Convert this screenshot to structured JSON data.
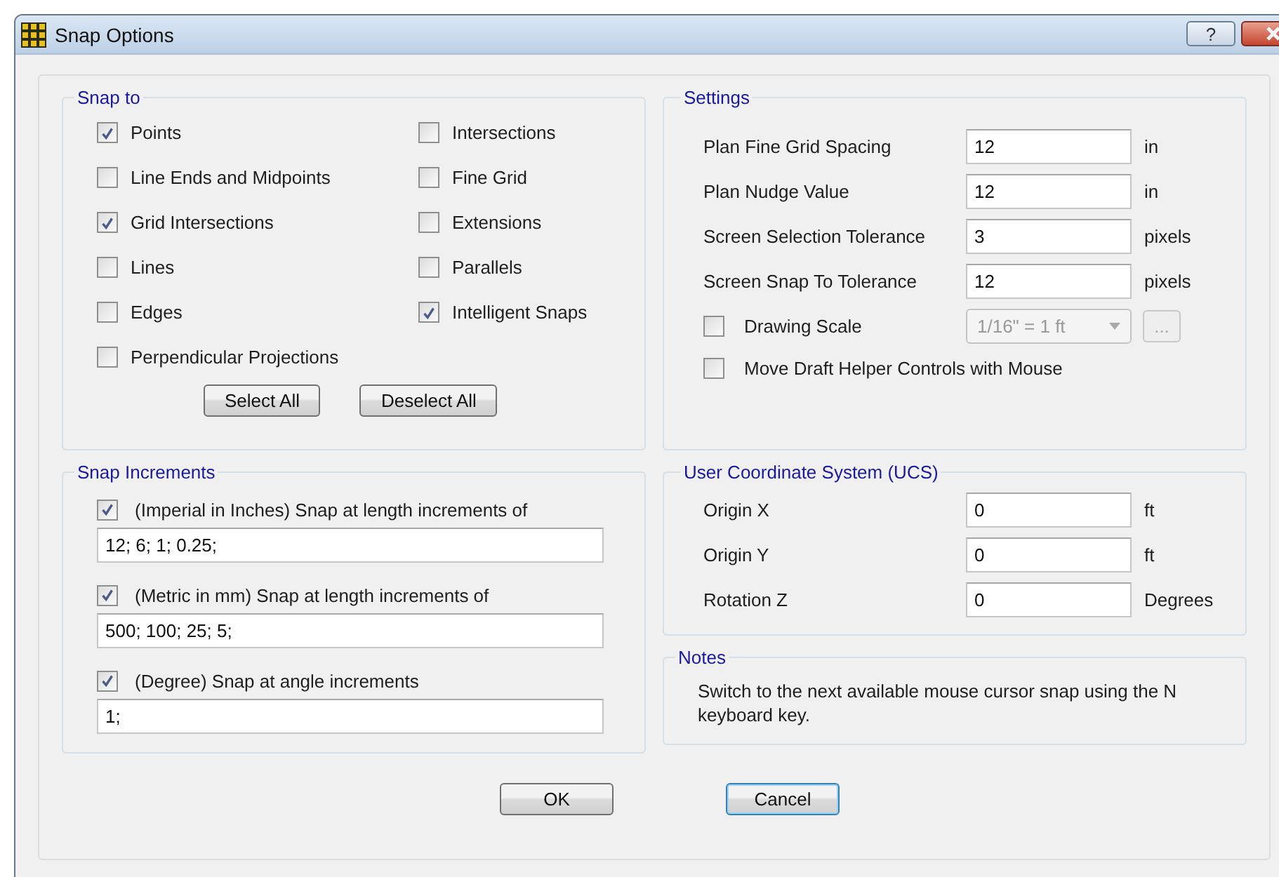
{
  "window": {
    "title": "Snap Options",
    "help": "?"
  },
  "snap_to": {
    "title": "Snap to",
    "columns": [
      [
        {
          "label": "Points",
          "checked": true
        },
        {
          "label": "Line Ends and Midpoints",
          "checked": false
        },
        {
          "label": "Grid Intersections",
          "checked": true
        },
        {
          "label": "Lines",
          "checked": false
        },
        {
          "label": "Edges",
          "checked": false
        },
        {
          "label": "Perpendicular Projections",
          "checked": false
        }
      ],
      [
        {
          "label": "Intersections",
          "checked": false
        },
        {
          "label": "Fine Grid",
          "checked": false
        },
        {
          "label": "Extensions",
          "checked": false
        },
        {
          "label": "Parallels",
          "checked": false
        },
        {
          "label": "Intelligent Snaps",
          "checked": true
        }
      ]
    ],
    "buttons": [
      "Select All",
      "Deselect All"
    ]
  },
  "settings": {
    "title": "Settings",
    "fields": [
      {
        "label": "Plan Fine Grid Spacing",
        "value": "12",
        "unit": "in"
      },
      {
        "label": "Plan Nudge Value",
        "value": "12",
        "unit": "in"
      },
      {
        "label": "Screen Selection Tolerance",
        "value": "3",
        "unit": "pixels"
      },
      {
        "label": "Screen Snap To Tolerance",
        "value": "12",
        "unit": "pixels"
      }
    ],
    "drawing_scale": {
      "label": "Drawing Scale",
      "checked": false,
      "value": "1/16\" = 1 ft",
      "disabled": true,
      "browse": "..."
    },
    "move_helper": {
      "label": "Move Draft Helper Controls with Mouse",
      "checked": false
    }
  },
  "snap_increments": {
    "title": "Snap Increments",
    "items": [
      {
        "label": "(Imperial in Inches) Snap at length increments of",
        "checked": true,
        "value": "12; 6; 1; 0.25;"
      },
      {
        "label": "(Metric in mm) Snap at length increments of",
        "checked": true,
        "value": "500; 100; 25; 5;"
      },
      {
        "label": "(Degree) Snap at angle increments",
        "checked": true,
        "value": "1;"
      }
    ]
  },
  "ucs": {
    "title": "User Coordinate System (UCS)",
    "fields": [
      {
        "label": "Origin X",
        "value": "0",
        "unit": "ft"
      },
      {
        "label": "Origin Y",
        "value": "0",
        "unit": "ft"
      },
      {
        "label": "Rotation Z",
        "value": "0",
        "unit": "Degrees"
      }
    ]
  },
  "notes": {
    "title": "Notes",
    "text": "Switch to the next available mouse cursor snap using the N keyboard key."
  },
  "buttons": [
    {
      "label": "OK",
      "focused": false
    },
    {
      "label": "Cancel",
      "focused": true
    }
  ]
}
